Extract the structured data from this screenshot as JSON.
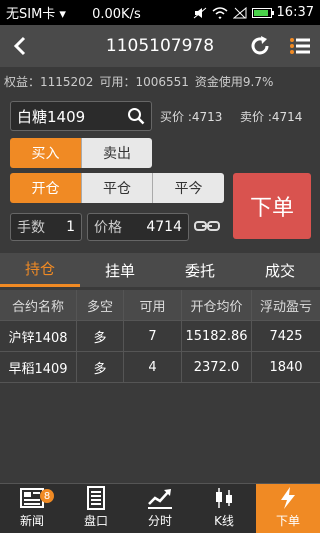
{
  "status_bar": {
    "carrier": "无SIM卡 ▾",
    "speed": "0.00K/s",
    "time": "16:37",
    "battery_level": 0.9
  },
  "header": {
    "title": "1105107978"
  },
  "account": {
    "equity": "权益：1115202",
    "available": "可用：1006551",
    "usage": "资金使用9.7%"
  },
  "order_form": {
    "symbol": "白糖1409",
    "buy_price": "买价 :4713",
    "sell_price": "卖价 :4714",
    "direction": {
      "buy": "买入",
      "sell": "卖出",
      "selected": "买入"
    },
    "offset": {
      "open": "开仓",
      "close": "平仓",
      "close_today": "平今",
      "selected": "开仓"
    },
    "quantity_label": "手数",
    "quantity": "1",
    "price_label": "价格",
    "price": "4714",
    "submit_label": "下单"
  },
  "tabs": [
    {
      "label": "持仓",
      "active": true
    },
    {
      "label": "挂单",
      "active": false
    },
    {
      "label": "委托",
      "active": false
    },
    {
      "label": "成交",
      "active": false
    }
  ],
  "positions": {
    "columns": [
      "合约名称",
      "多空",
      "可用",
      "开仓均价",
      "浮动盈亏"
    ],
    "rows": [
      [
        "沪锌1408",
        "多",
        "7",
        "15182.86",
        "7425"
      ],
      [
        "早稻1409",
        "多",
        "4",
        "2372.0",
        "1840"
      ]
    ]
  },
  "bottom_nav": [
    {
      "label": "新闻",
      "icon": "news-icon",
      "badge": "8"
    },
    {
      "label": "盘口",
      "icon": "order-book-icon"
    },
    {
      "label": "分时",
      "icon": "timeshare-chart-icon"
    },
    {
      "label": "K线",
      "icon": "candlestick-icon"
    },
    {
      "label": "下单",
      "icon": "lightning-icon",
      "active": true
    }
  ],
  "colors": {
    "accent": "#f08a24",
    "submit": "#d9534f",
    "background": "#3a3a3a"
  }
}
